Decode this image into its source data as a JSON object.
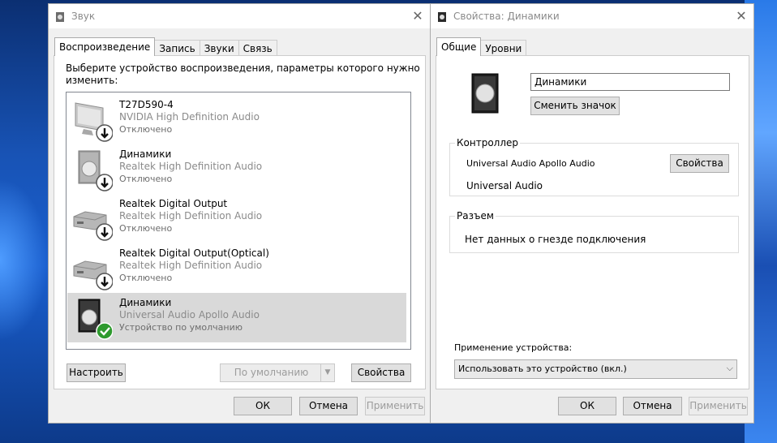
{
  "colors": {
    "accent": "#1a5fcf",
    "selected_row": "#d9d9d9",
    "disabled_text": "#9c9c9c",
    "default_check": "#2e9a2e"
  },
  "sound_dialog": {
    "title": "Звук",
    "tabs": [
      {
        "label": "Воспроизведение"
      },
      {
        "label": "Запись"
      },
      {
        "label": "Звуки"
      },
      {
        "label": "Связь"
      }
    ],
    "instruction_line1": "Выберите устройство воспроизведения, параметры которого нужно",
    "instruction_line2": "изменить:",
    "devices": [
      {
        "name": "T27D590-4",
        "driver": "NVIDIA High Definition Audio",
        "status": "Отключено",
        "icon": "monitor-icon",
        "badge": "down-arrow-icon"
      },
      {
        "name": "Динамики",
        "driver": "Realtek High Definition Audio",
        "status": "Отключено",
        "icon": "speaker-icon",
        "badge": "down-arrow-icon"
      },
      {
        "name": "Realtek Digital Output",
        "driver": "Realtek High Definition Audio",
        "status": "Отключено",
        "icon": "digital-output-icon",
        "badge": "down-arrow-icon"
      },
      {
        "name": "Realtek Digital Output(Optical)",
        "driver": "Realtek High Definition Audio",
        "status": "Отключено",
        "icon": "digital-output-icon",
        "badge": "down-arrow-icon"
      },
      {
        "name": "Динамики",
        "driver": "Universal Audio Apollo Audio",
        "status": "Устройство по умолчанию",
        "icon": "speaker-icon",
        "badge": "check-icon",
        "selected": true
      }
    ],
    "configure_label": "Настроить",
    "set_default_label": "По умолчанию",
    "properties_label": "Свойства",
    "ok_label": "ОК",
    "cancel_label": "Отмена",
    "apply_label": "Применить"
  },
  "props_dialog": {
    "title": "Свойства: Динамики",
    "tabs": [
      {
        "label": "Общие"
      },
      {
        "label": "Уровни"
      }
    ],
    "device_name_value": "Динамики",
    "change_icon_label": "Сменить значок",
    "controller_label": "Контроллер",
    "controller_name": "Universal Audio Apollo Audio",
    "controller_properties_label": "Свойства",
    "controller_vendor": "Universal Audio",
    "jack_label": "Разъем",
    "jack_info": "Нет данных о гнезде подключения",
    "usage_label": "Применение устройства:",
    "usage_value": "Использовать это устройство (вкл.)",
    "ok_label": "ОК",
    "cancel_label": "Отмена",
    "apply_label": "Применить"
  }
}
